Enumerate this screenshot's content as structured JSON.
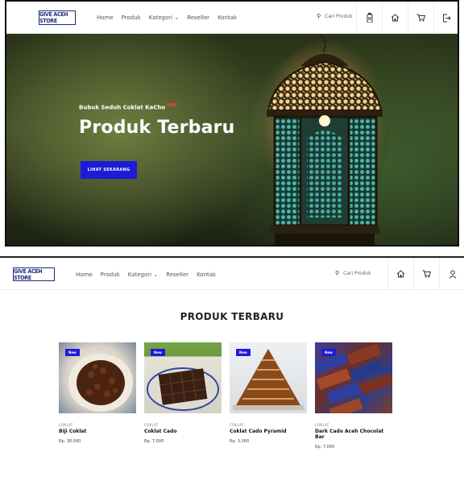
{
  "brand": {
    "logo_text": "GIVE ACEH STORE"
  },
  "hero_nav": {
    "menu": [
      "Home",
      "Produk",
      "Kategori ⌄",
      "Reseller",
      "Kontak"
    ],
    "search_placeholder": "Cari Produk",
    "icons": [
      "bottle-icon",
      "home-icon",
      "cart-icon",
      "logout-icon"
    ]
  },
  "hero": {
    "subtitle": "Bubuk Seduh Coklat KaCho",
    "new_tag": "NEW",
    "title": "Produk Terbaru",
    "button_label": "LIHAT SEKARANG"
  },
  "products_nav": {
    "menu": [
      "Home",
      "Produk",
      "Kategori ⌄",
      "Reseller",
      "Kontak"
    ],
    "search_placeholder": "Cari Produk",
    "icons": [
      "home-icon",
      "cart-icon",
      "user-icon"
    ]
  },
  "products": {
    "section_title": "PRODUK TERBARU",
    "items": [
      {
        "badge": "New",
        "category": "COKLAT",
        "name": "Biji Coklat",
        "price": "Rp. 30,000"
      },
      {
        "badge": "New",
        "category": "COKLAT",
        "name": "Coklat Cado",
        "price": "Rp. 7,000"
      },
      {
        "badge": "New",
        "category": "COKLAT",
        "name": "Coklat Cado Pyramid",
        "price": "Rp. 3,000"
      },
      {
        "badge": "New",
        "category": "COKLAT",
        "name": "Dark Cado Aceh Chocolat Bar",
        "price": "Rp. 7,000"
      }
    ]
  },
  "colors": {
    "accent": "#1c1bd8",
    "logo": "#1e2a7a",
    "new_tag": "#ff3b3b"
  }
}
